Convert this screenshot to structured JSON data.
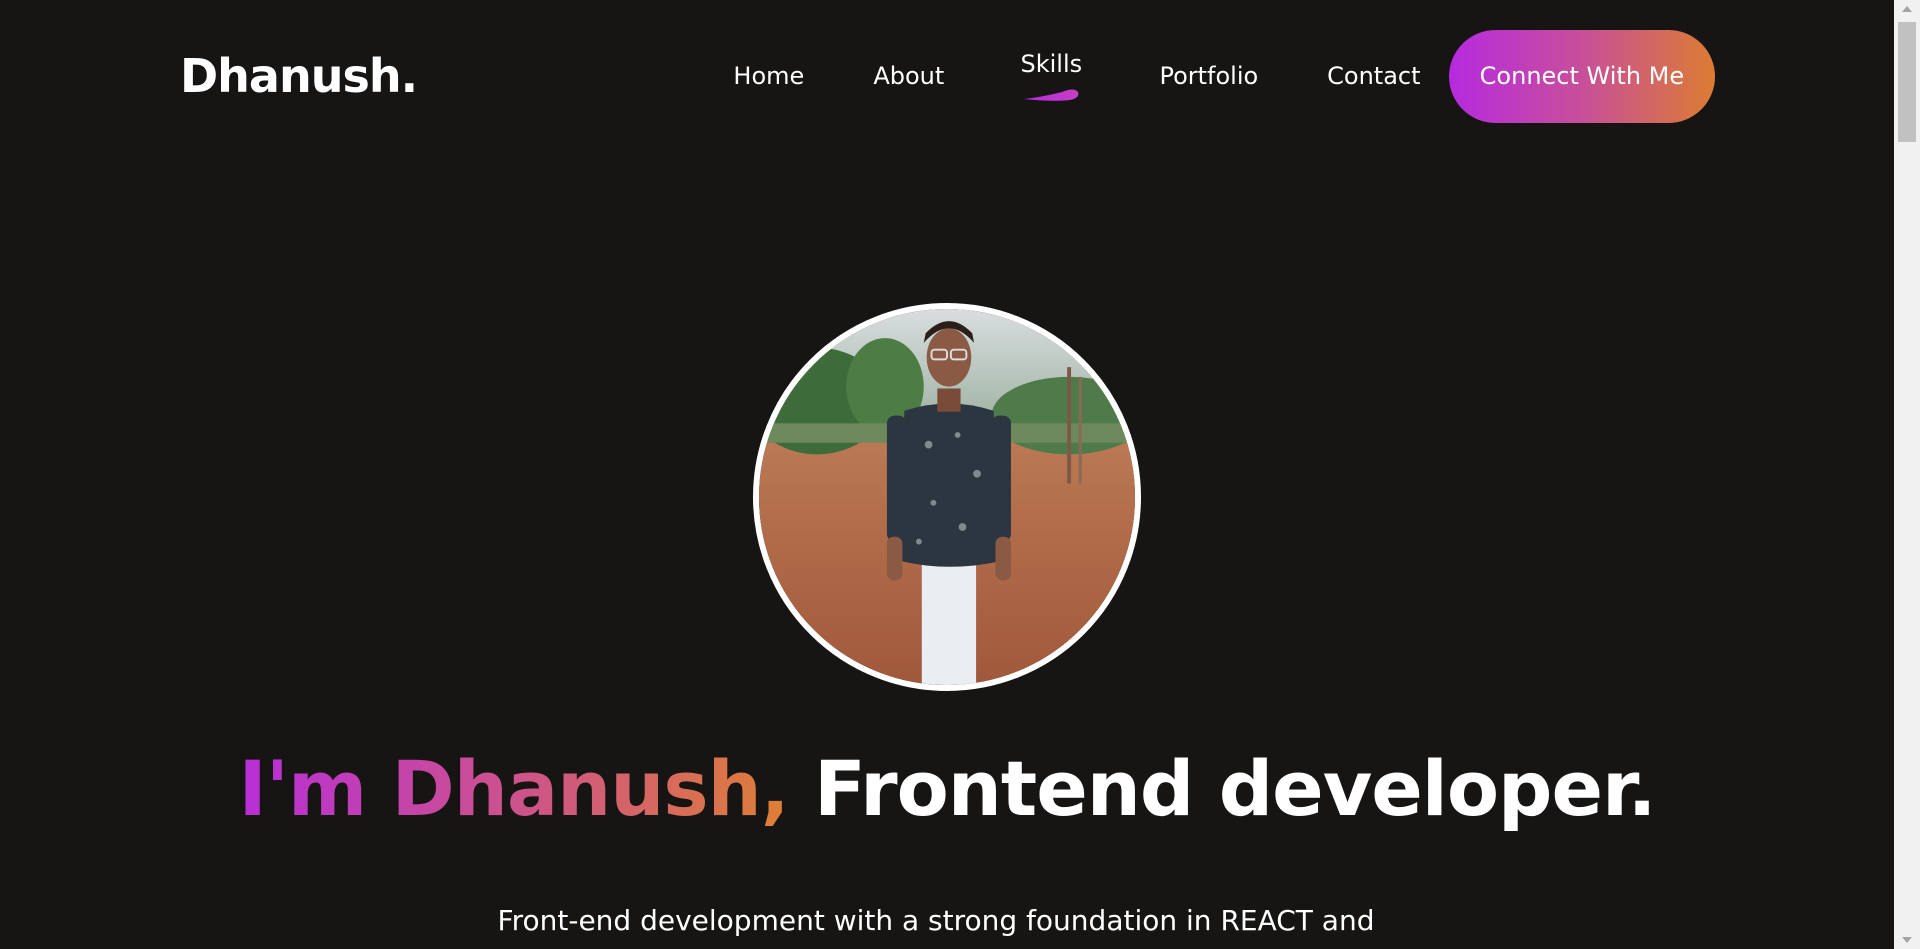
{
  "brand": {
    "logo": "Dhanush."
  },
  "nav": {
    "items": [
      {
        "label": "Home"
      },
      {
        "label": "About"
      },
      {
        "label": "Skills",
        "active": true
      },
      {
        "label": "Portfolio"
      },
      {
        "label": "Contact"
      }
    ],
    "cta_label": "Connect With Me"
  },
  "hero": {
    "headline_gradient": "I'm Dhanush,",
    "headline_rest": "Frontend developer.",
    "subtitle": "Front-end development with a strong foundation in REACT and"
  },
  "colors": {
    "background": "#161514",
    "accent_start": "#b62adf",
    "accent_mid": "#c84f9a",
    "accent_end": "#dc7c32",
    "text": "#ffffff"
  },
  "icons": {
    "active_nav_marker": "brush-stroke-icon",
    "avatar": "profile-photo"
  }
}
